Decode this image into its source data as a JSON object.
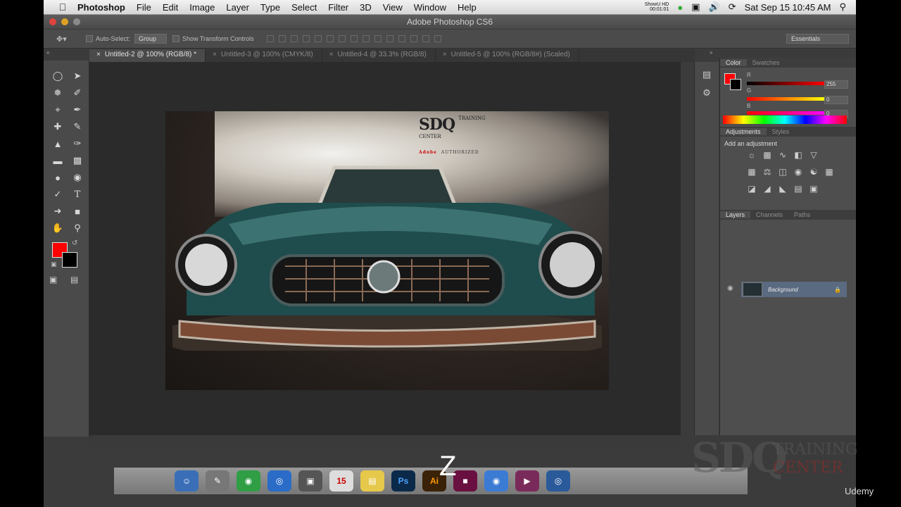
{
  "menubar": {
    "app_name": "Photoshop",
    "items": [
      "File",
      "Edit",
      "Image",
      "Layer",
      "Type",
      "Select",
      "Filter",
      "3D",
      "View",
      "Window",
      "Help"
    ],
    "status_app": "ShowU HD",
    "status_time_small": "00:01:01",
    "datetime": "Sat Sep 15  10:45 AM"
  },
  "window": {
    "title": "Adobe Photoshop CS6"
  },
  "options_bar": {
    "auto_select_label": "Auto-Select:",
    "auto_select_value": "Group",
    "transform_label": "Show Transform Controls",
    "workspace": "Essentials"
  },
  "document_tabs": [
    {
      "label": "Untitled-2 @ 100% (RGB/8) *",
      "active": true
    },
    {
      "label": "Untitled-3 @ 100% (CMYK/8)",
      "active": false
    },
    {
      "label": "Untitled-4 @ 33.3% (RGB/8)",
      "active": false
    },
    {
      "label": "Untitled-5 @ 100% (RGB/8#) (Scaled)",
      "active": false
    }
  ],
  "canvas_logo": {
    "line1": "SDQ",
    "line2": "TRAINING",
    "line3": "CENTER",
    "authorized": "AUTHORIZED",
    "adobe": "Adobe"
  },
  "color_panel": {
    "tabs": [
      "Color",
      "Swatches"
    ],
    "r_label": "R",
    "g_label": "G",
    "b_label": "B",
    "r": "255",
    "g": "0",
    "b": "0"
  },
  "adjustments_panel": {
    "tabs": [
      "Adjustments",
      "Styles"
    ],
    "title": "Add an adjustment"
  },
  "layers_panel": {
    "tabs": [
      "Layers",
      "Channels",
      "Paths"
    ],
    "layer_name": "Background"
  },
  "overlay": {
    "key_letter": "Z",
    "watermark_big": "SDQ",
    "watermark_training": "TRAINING",
    "watermark_center": "CENTER",
    "udemy": "Udemy"
  },
  "colors": {
    "foreground": "#ff0000",
    "background": "#000000"
  }
}
